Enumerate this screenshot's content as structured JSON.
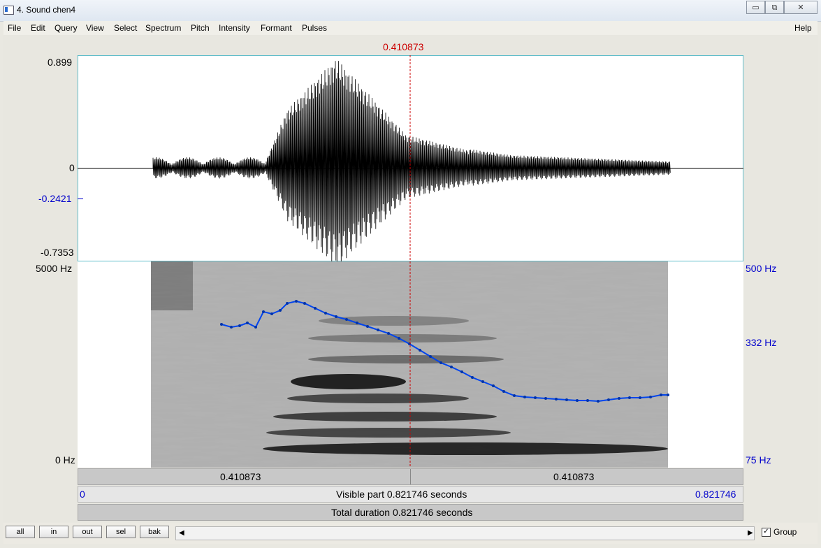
{
  "window": {
    "title": "4. Sound chen4",
    "minimize": "▭",
    "restore": "⧉",
    "close": "✕"
  },
  "menu": [
    "File",
    "Edit",
    "Query",
    "View",
    "Select",
    "Spectrum",
    "Pitch",
    "Intensity",
    "Formant",
    "Pulses"
  ],
  "help": "Help",
  "cursor_time": "0.410873",
  "waveform": {
    "ymax": "0.899",
    "yzero": "0",
    "ycursor": "-0.2421",
    "ymin": "-0.7353"
  },
  "spectrogram": {
    "fmax": "5000 Hz",
    "fmin": "0 Hz"
  },
  "pitch_axis": {
    "max": "500 Hz",
    "mid": "332 Hz",
    "min": "75 Hz"
  },
  "timebar": {
    "left": "0.410873",
    "right": "0.410873"
  },
  "visible": {
    "start": "0",
    "label": "Visible part 0.821746 seconds",
    "end": "0.821746"
  },
  "total": {
    "label": "Total duration 0.821746 seconds"
  },
  "buttons": {
    "all": "all",
    "in": "in",
    "out": "out",
    "sel": "sel",
    "bak": "bak"
  },
  "group": {
    "label": "Group",
    "checked": true
  },
  "colors": {
    "cursor": "#cc0000",
    "pitch": "#0044ee",
    "axis_blue": "#0000cc"
  }
}
